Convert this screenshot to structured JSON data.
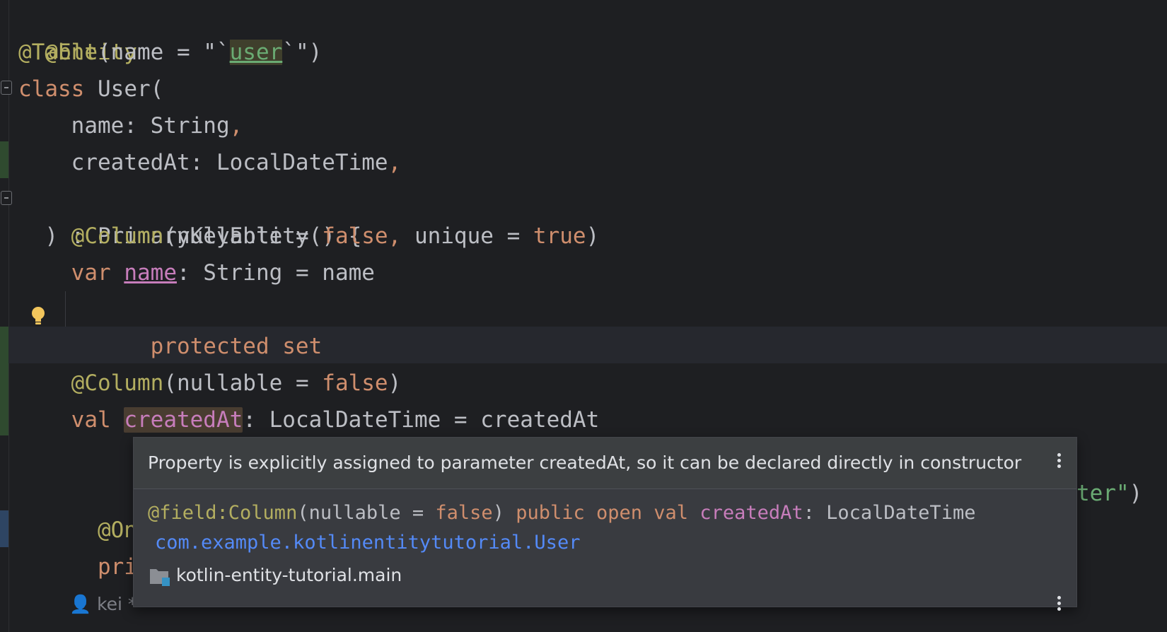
{
  "editor": {
    "lines": {
      "l1": "@Entity",
      "l2_ann": "@Table",
      "l2_open": "(name = \"`",
      "l2_word": "user",
      "l2_close": "`\")",
      "l3_kw": "class",
      "l3_rest": " User(",
      "l4_a": "    name: String",
      "l4_comma": ",",
      "l5_a": "    createdAt: LocalDateTime",
      "l5_comma": ",",
      "l6": ") : PrimaryKeyEntity() {",
      "l7_ann": "    @Column",
      "l7_a": "(nullable = ",
      "l7_false": "false",
      "l7_comma": ",",
      "l7_b": " unique = ",
      "l7_true": "true",
      "l7_c": ")",
      "l8_kw": "    var",
      "l8_sp": " ",
      "l8_prop": "name",
      "l8_rest": ": String = name",
      "l9": "        protected set",
      "l11_ann": "    @Column",
      "l11_a": "(nullable = ",
      "l11_false": "false",
      "l11_c": ")",
      "l12_kw": "    val",
      "l12_sp": " ",
      "l12_prop": "createdAt",
      "l12_rest": ": LocalDateTime = createdAt",
      "l14_a": "    @OneT",
      "l14_b": "ter\")",
      "l15": "    priva"
    },
    "author_inlay": "👤 kei *"
  },
  "popup": {
    "message": "Property is explicitly assigned to parameter createdAt, so it can be declared directly in constructor",
    "sig_ann": "@field:Column",
    "sig_a": "(nullable = ",
    "sig_false": "false",
    "sig_b": ") ",
    "sig_kw": "public open val",
    "sig_sp": " ",
    "sig_prop": "createdAt",
    "sig_rest": ": LocalDateTime",
    "fqn": "com.example.kotlinentitytutorial.User",
    "module": "kotlin-entity-tutorial.main"
  },
  "colors": {
    "background": "#1e1f22",
    "annotation": "#b3ae60",
    "keyword": "#cf8e6d",
    "property": "#c77dbb",
    "link": "#548af7"
  },
  "icons": [
    "intention-bulb-icon",
    "fold-marker-icon",
    "more-vertical-icon",
    "module-folder-icon",
    "person-icon"
  ]
}
